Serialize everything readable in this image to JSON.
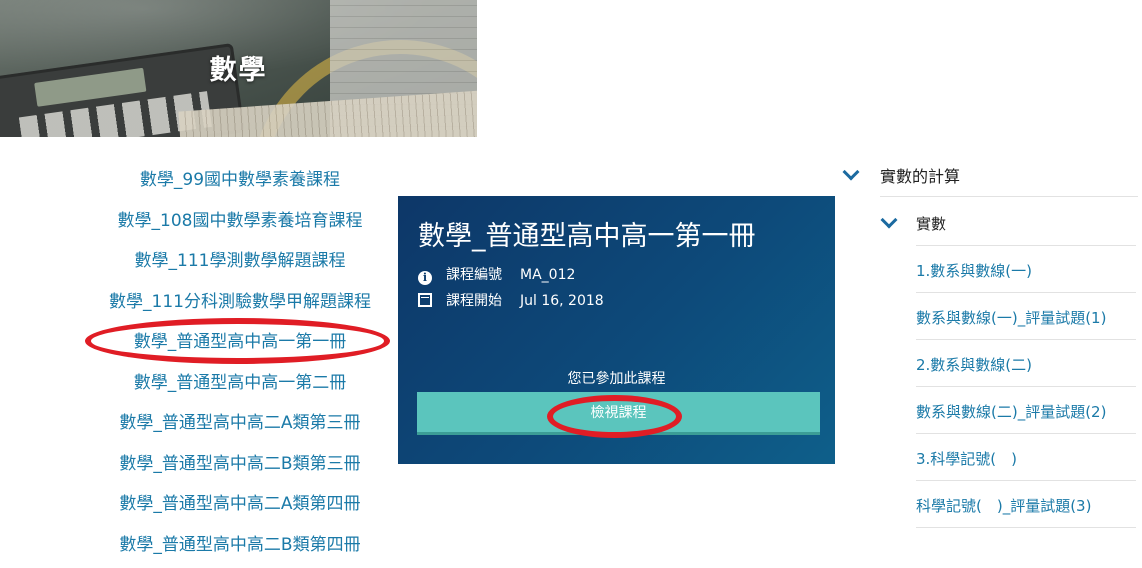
{
  "banner": {
    "title": "數學"
  },
  "course_list": {
    "items": [
      "數學_99國中數學素養課程",
      "數學_108國中數學素養培育課程",
      "數學_111學測數學解題課程",
      "數學_111分科測驗數學甲解題課程",
      "數學_普通型高中高一第一冊",
      "數學_普通型高中高一第二冊",
      "數學_普通型高中高二A類第三冊",
      "數學_普通型高中高二B類第三冊",
      "數學_普通型高中高二A類第四冊",
      "數學_普通型高中高二B類第四冊"
    ],
    "highlighted_index": 4,
    "link_color": "#1b7aa8"
  },
  "course_card": {
    "title": "數學_普通型高中高一第一冊",
    "code_label": "課程編號",
    "code_value": "MA_012",
    "start_label": "課程開始",
    "start_value": "Jul 16, 2018",
    "enrolled_text": "您已參加此課程",
    "view_button": "檢視課程",
    "info_icon": "info-icon",
    "calendar_icon": "calendar-icon",
    "accent_color": "#5bc5bd"
  },
  "annotation_color": "#e01d25",
  "outline": {
    "section_title": "實數的計算",
    "subsection_title": "實數",
    "units": [
      "1.數系與數線(一)",
      "數系與數線(一)_評量試題(1)",
      "2.數系與數線(二)",
      "數系與數線(二)_評量試題(2)",
      "3.科學記號(　)",
      "科學記號(　)_評量試題(3)"
    ]
  }
}
